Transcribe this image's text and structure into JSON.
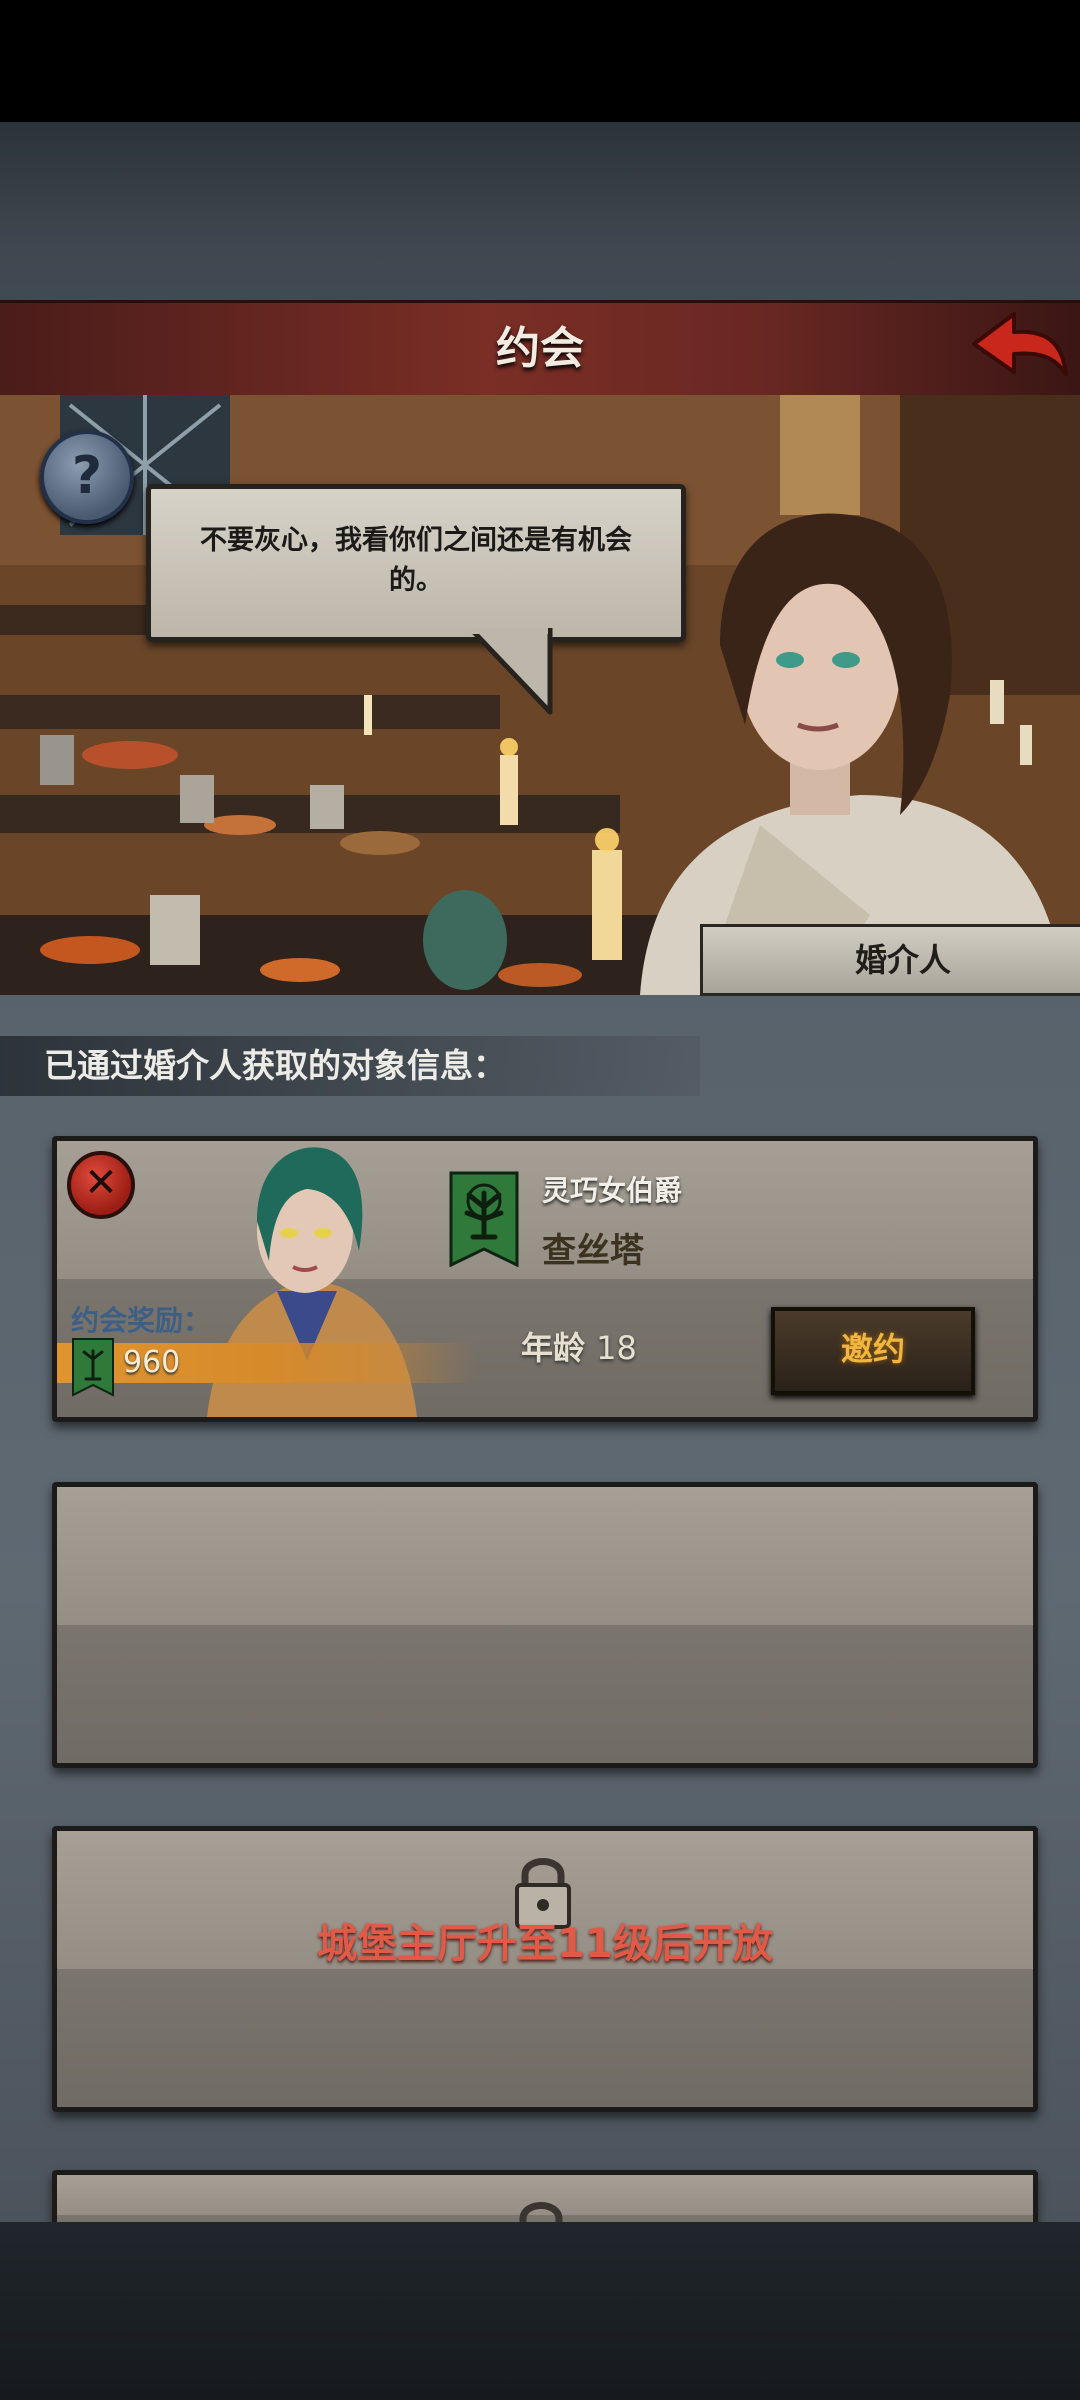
{
  "header": {
    "title": "约会"
  },
  "dialogue": {
    "speech": "不要灰心，我看你们之间还是有机会的。",
    "speaker": "婚介人"
  },
  "section": {
    "label": "已通过婚介人获取的对象信息："
  },
  "candidates": [
    {
      "title": "灵巧女伯爵",
      "name": "查丝塔",
      "age_label": "年龄",
      "age": "18",
      "invite_label": "邀约",
      "reward_label": "约会奖励：",
      "reward_value": "960"
    }
  ],
  "locked_slot": {
    "text": "城堡主厅升至11级后开放"
  },
  "icons": {
    "back": "back-arrow-icon",
    "help": "question-icon",
    "close": "close-icon",
    "house_banner": "tree-banner-icon",
    "lock": "lock-icon"
  },
  "colors": {
    "title_bar": "#7a2e25",
    "invite_text": "#f0b640",
    "locked_text": "#e05a47",
    "reward_label": "#3d5f86"
  }
}
